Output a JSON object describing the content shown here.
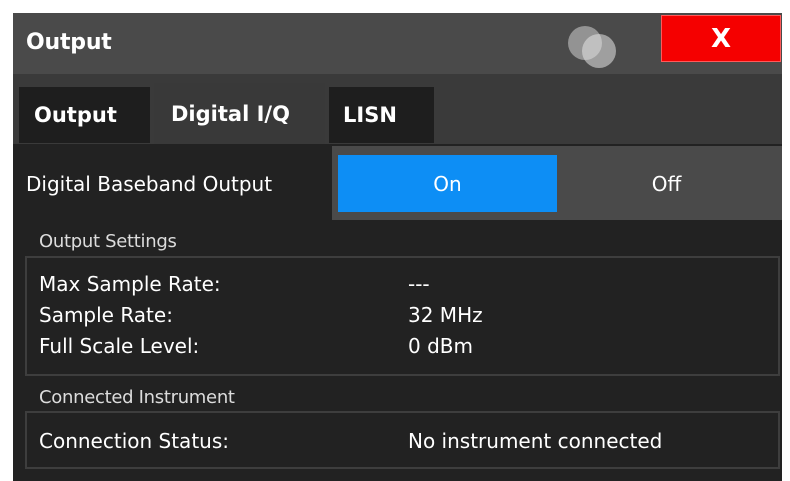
{
  "dialog": {
    "title": "Output",
    "close_label": "X"
  },
  "tabs": [
    {
      "label": "Output",
      "active": false
    },
    {
      "label": "Digital I/Q",
      "active": true
    },
    {
      "label": "LISN",
      "active": false
    }
  ],
  "baseband": {
    "label": "Digital Baseband Output",
    "on_label": "On",
    "off_label": "Off",
    "selected": "On"
  },
  "output_settings": {
    "title": "Output Settings",
    "rows": [
      {
        "label": "Max Sample Rate:",
        "value": "---"
      },
      {
        "label": "Sample Rate:",
        "value": "32 MHz"
      },
      {
        "label": "Full Scale Level:",
        "value": "0 dBm"
      }
    ]
  },
  "connected_instrument": {
    "title": "Connected Instrument",
    "rows": [
      {
        "label": "Connection Status:",
        "value": "No instrument connected"
      }
    ]
  },
  "colors": {
    "accent": "#0d8ef5",
    "close": "#f50000",
    "titlebar": "#4a4a4a",
    "panel": "#222222"
  },
  "icons": {
    "title_decoration": "overlapping-circles-icon"
  }
}
